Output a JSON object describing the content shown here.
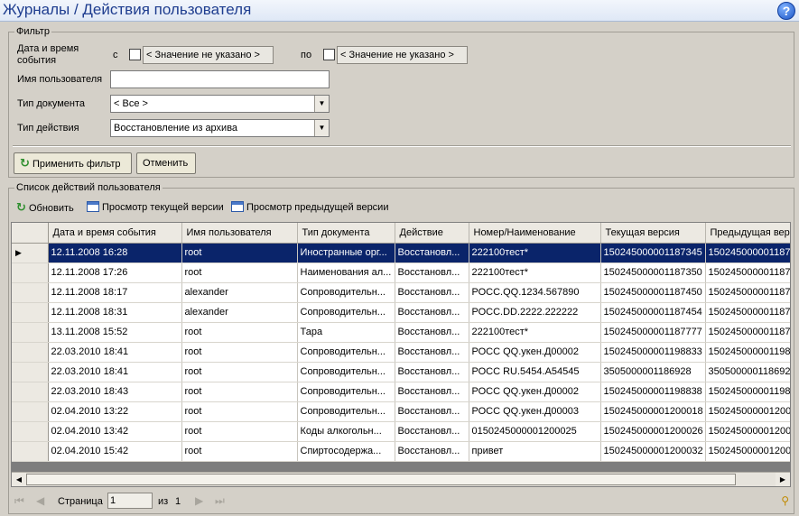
{
  "header": {
    "title": "Журналы / Действия пользователя",
    "help_icon": "help-icon"
  },
  "filter": {
    "legend": "Фильтр",
    "date_label": "Дата и время события",
    "from_label": "с",
    "from_value": "< Значение не указано >",
    "to_label": "по",
    "to_value": "< Значение не указано >",
    "user_label": "Имя пользователя",
    "user_value": "",
    "doc_type_label": "Тип документа",
    "doc_type_value": "< Все >",
    "action_type_label": "Тип действия",
    "action_type_value": "Восстановление из архива",
    "apply_button": "Применить фильтр",
    "cancel_button": "Отменить"
  },
  "list": {
    "legend": "Список действий пользователя",
    "toolbar": {
      "refresh": "Обновить",
      "view_current": "Просмотр текущей версии",
      "view_previous": "Просмотр предыдущей версии"
    },
    "columns": [
      "Дата и время события",
      "Имя пользователя",
      "Тип документа",
      "Действие",
      "Номер/Наименование",
      "Текущая версия",
      "Предыдущая вер"
    ],
    "rows": [
      [
        "12.11.2008 16:28",
        "root",
        "Иностранные орг...",
        "Восстановл...",
        "222100тест*",
        "150245000001187345",
        "150245000001187"
      ],
      [
        "12.11.2008 17:26",
        "root",
        "Наименования ал...",
        "Восстановл...",
        "222100тест*",
        "150245000001187350",
        "150245000001187"
      ],
      [
        "12.11.2008 18:17",
        "alexander",
        "Сопроводительн...",
        "Восстановл...",
        "РОСС.QQ.1234.567890",
        "150245000001187450",
        "150245000001187"
      ],
      [
        "12.11.2008 18:31",
        "alexander",
        "Сопроводительн...",
        "Восстановл...",
        "РОСС.DD.2222.222222",
        "150245000001187454",
        "150245000001187"
      ],
      [
        "13.11.2008 15:52",
        "root",
        "Тара",
        "Восстановл...",
        "222100тест*",
        "150245000001187777",
        "150245000001187"
      ],
      [
        "22.03.2010 18:41",
        "root",
        "Сопроводительн...",
        "Восстановл...",
        "РОСС QQ.укен.Д00002",
        "150245000001198833",
        "150245000001198"
      ],
      [
        "22.03.2010 18:41",
        "root",
        "Сопроводительн...",
        "Восстановл...",
        "РОСС RU.5454.А54545",
        "3505000001186928",
        "350500000118692"
      ],
      [
        "22.03.2010 18:43",
        "root",
        "Сопроводительн...",
        "Восстановл...",
        "РОСС QQ.укен.Д00002",
        "150245000001198838",
        "150245000001198"
      ],
      [
        "02.04.2010 13:22",
        "root",
        "Сопроводительн...",
        "Восстановл...",
        "РОСС QQ.укен.Д00003",
        "150245000001200018",
        "150245000001200"
      ],
      [
        "02.04.2010 13:42",
        "root",
        "Коды алкогольн...",
        "Восстановл...",
        "0150245000001200025",
        "150245000001200026",
        "150245000001200"
      ],
      [
        "02.04.2010 15:42",
        "root",
        "Спиртосодержа...",
        "Восстановл...",
        "привет",
        "150245000001200032",
        "150245000001200"
      ]
    ],
    "selected_row": 0
  },
  "pager": {
    "page_label": "Страница",
    "page_value": "1",
    "of_label": "из",
    "total_pages": "1"
  }
}
